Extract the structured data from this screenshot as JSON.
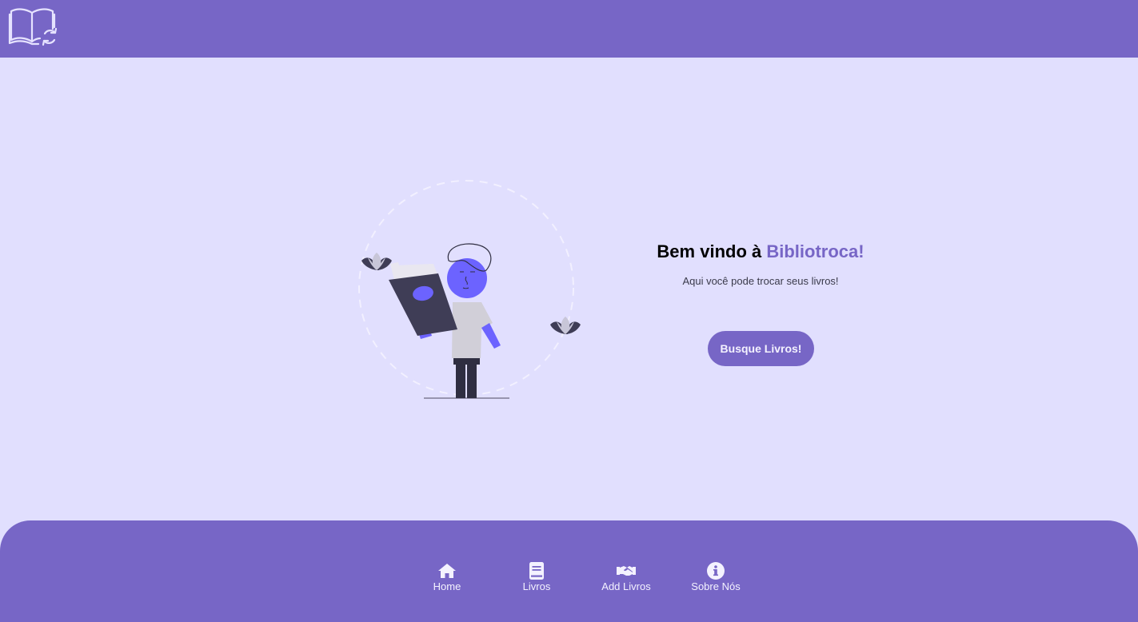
{
  "header": {
    "logo_icon": "book-exchange-icon"
  },
  "hero": {
    "title_prefix": "Bem vindo à ",
    "title_brand": "Bibliotroca!",
    "subtitle": "Aqui você pode trocar seus livros!",
    "cta_label": "Busque Livros!",
    "illustration": "person-reading-book-illustration"
  },
  "footer": {
    "nav": [
      {
        "label": "Home",
        "icon": "home-icon"
      },
      {
        "label": "Livros",
        "icon": "book-icon"
      },
      {
        "label": "Add Livros",
        "icon": "handshake-icon"
      },
      {
        "label": "Sobre Nós",
        "icon": "info-icon"
      }
    ]
  },
  "colors": {
    "primary": "#7766c6",
    "background": "#e1dffe",
    "accent_figure": "#6c63ff",
    "dark": "#3f3d56"
  }
}
